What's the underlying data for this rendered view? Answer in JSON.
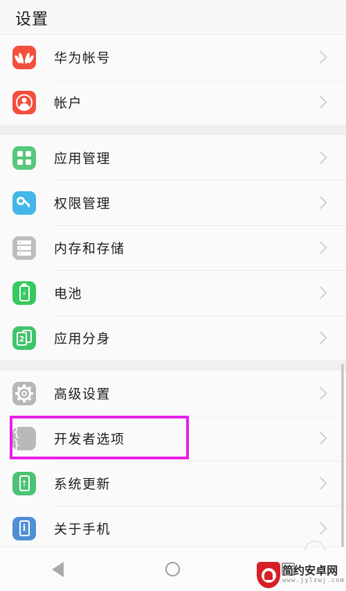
{
  "header": {
    "title": "设置"
  },
  "groups": [
    {
      "name": "accounts",
      "rows": [
        {
          "label": "华为帐号",
          "icon": "huawei-logo-icon"
        },
        {
          "label": "帐户",
          "icon": "account-person-icon"
        }
      ]
    },
    {
      "name": "device",
      "rows": [
        {
          "label": "应用管理",
          "icon": "app-grid-icon"
        },
        {
          "label": "权限管理",
          "icon": "key-icon"
        },
        {
          "label": "内存和存储",
          "icon": "storage-icon"
        },
        {
          "label": "电池",
          "icon": "battery-icon"
        },
        {
          "label": "应用分身",
          "icon": "app-twin-icon"
        }
      ]
    },
    {
      "name": "system",
      "rows": [
        {
          "label": "高级设置",
          "icon": "gear-icon"
        },
        {
          "label": "开发者选项",
          "icon": "braces-icon"
        },
        {
          "label": "系统更新",
          "icon": "system-update-icon"
        },
        {
          "label": "关于手机",
          "icon": "about-phone-icon"
        }
      ]
    }
  ],
  "highlight": {
    "target_label": "开发者选项",
    "color": "#e81ee8"
  },
  "navbar": {
    "back": "back-triangle-icon",
    "home": "home-circle-icon",
    "recents": "recents-square-icon"
  },
  "watermark": {
    "site_name": "简约安卓网",
    "site_url": "www.jylzwj.com",
    "brand_color": "#d81f26"
  },
  "chevron_icon": "chevron-right-icon"
}
